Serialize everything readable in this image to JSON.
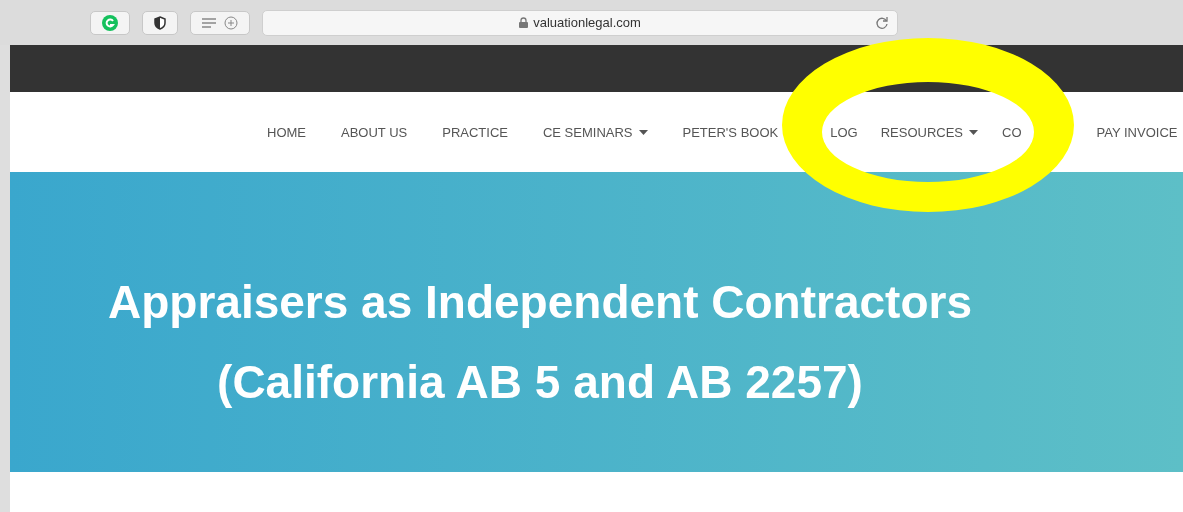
{
  "browser": {
    "url": "valuationlegal.com"
  },
  "nav": {
    "items": [
      {
        "label": "HOME",
        "dropdown": false
      },
      {
        "label": "ABOUT US",
        "dropdown": false
      },
      {
        "label": "PRACTICE",
        "dropdown": false
      },
      {
        "label": "CE SEMINARS",
        "dropdown": true
      },
      {
        "label": "PETER'S BOOK",
        "dropdown": false
      },
      {
        "label": "LOG",
        "dropdown": false
      },
      {
        "label": "RESOURCES",
        "dropdown": true
      },
      {
        "label": "CO",
        "dropdown": false
      },
      {
        "label": "PAY INVOICE",
        "dropdown": false
      }
    ]
  },
  "hero": {
    "title_lines": [
      "Appraisers as Independent Contractors",
      "(California AB 5 and AB 2257)"
    ]
  },
  "annotation": {
    "kind": "ellipse"
  }
}
